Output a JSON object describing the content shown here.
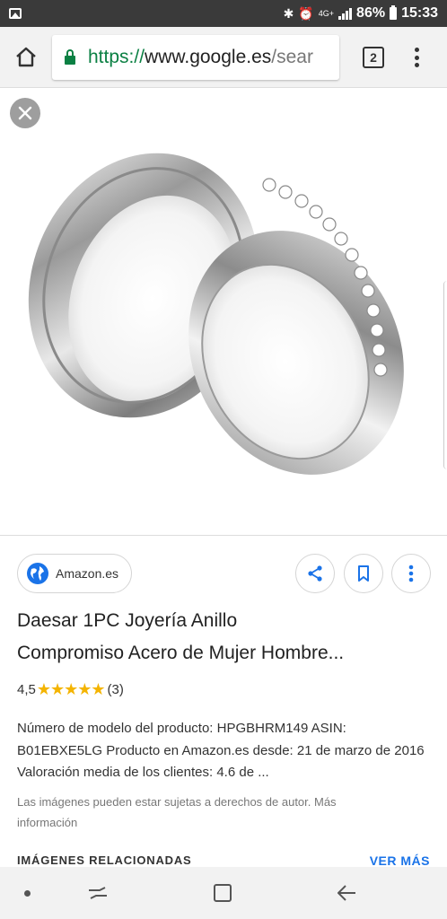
{
  "status_bar": {
    "network": "4G+",
    "battery": "86%",
    "time": "15:33"
  },
  "browser": {
    "url_scheme": "https://",
    "url_domain": "www.google.es",
    "url_path": "/sear",
    "tab_count": "2"
  },
  "result": {
    "source": "Amazon.es",
    "title_line1": "Daesar 1PC Joyería Anillo",
    "title_line2": "Compromiso Acero de Mujer Hombre...",
    "rating_value": "4,5",
    "rating_stars": 4.5,
    "rating_stars_text": "★★★★★",
    "rating_count": "(3)",
    "description": "Número de modelo del producto: HPGBHRM149 ASIN: B01EBXE5LG Producto en Amazon.es desde: 21 de marzo de 2016 Valoración media de los clientes: 4.6 de ...",
    "copyright": "Las imágenes pueden estar sujetas a derechos de autor. Más información"
  },
  "related": {
    "label": "IMÁGENES RELACIONADAS",
    "more": "VER MÁS"
  },
  "colors": {
    "accent": "#1a73e8",
    "secure": "#0b8043",
    "star": "#f4b400"
  },
  "icons": [
    "image-notification-icon",
    "bluetooth-icon",
    "alarm-icon",
    "signal-icon",
    "battery-icon",
    "home-icon",
    "lock-icon",
    "tab-switcher-icon",
    "menu-icon",
    "close-icon",
    "globe-icon",
    "share-icon",
    "bookmark-icon",
    "more-vert-icon",
    "nav-dot-icon",
    "recents-icon",
    "home-square-icon",
    "back-arrow-icon"
  ]
}
